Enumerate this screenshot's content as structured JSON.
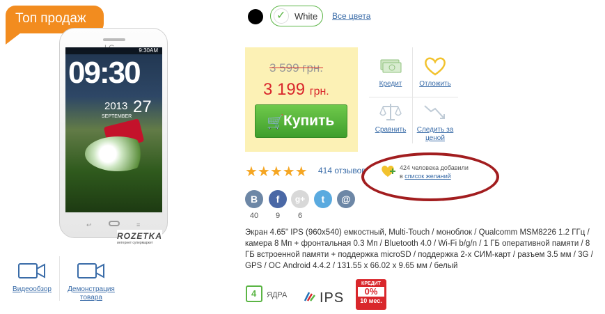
{
  "badge": {
    "label": "Топ продаж"
  },
  "phone": {
    "brand": "LG",
    "status_time": "9:30AM",
    "clock": "09:30",
    "year": "2013",
    "day": "27",
    "month": "SEPTEMBER"
  },
  "watermark": {
    "name": "ROZETKA",
    "tagline": "интернет супермаркет"
  },
  "media": {
    "review_label": "Видеообзор",
    "demo_label": "Демонстрация товара"
  },
  "colors": {
    "selected": "White",
    "all_label": "Все цвета",
    "options": [
      "#000000",
      "#ffffff"
    ]
  },
  "price": {
    "old": "3 599 грн.",
    "new_value": "3 199",
    "new_currency": "грн.",
    "buy_label": "Купить"
  },
  "actions": {
    "credit": "Кредит",
    "postpone": "Отложить",
    "compare": "Сравнить",
    "track_price": "Следить за ценой"
  },
  "rating": {
    "stars": 5,
    "reviews": "414 отзывов"
  },
  "wishlist": {
    "line1": "424 человека добавили",
    "line2_prefix": "в",
    "line2_link": "список желаний"
  },
  "social": [
    {
      "name": "vk",
      "glyph": "В",
      "count": "40",
      "color": "#6d87a6"
    },
    {
      "name": "facebook",
      "glyph": "f",
      "count": "9",
      "color": "#4a68a6"
    },
    {
      "name": "googleplus",
      "glyph": "g+",
      "count": "6",
      "color": "#d8d8d8"
    },
    {
      "name": "twitter",
      "glyph": "t",
      "count": "",
      "color": "#5aaadf"
    },
    {
      "name": "email",
      "glyph": "@",
      "count": "",
      "color": "#6d87a6"
    }
  ],
  "description": "Экран 4.65\" IPS (960x540) емкостный, Multi-Touch / моноблок / Qualcomm MSM8226 1.2 ГГц / камера 8 Мп + фронтальная 0.3 Мп / Bluetooth 4.0 / Wi-Fi b/g/n / 1 ГБ оперативной памяти / 8 ГБ встроенной памяти + поддержка microSD / поддержка 2-х СИМ-карт / разъем 3.5 мм / 3G / GPS / ОС Android 4.4.2 / 131.55 x 66.02 x 9.65 мм / белый",
  "features": {
    "cores_number": "4",
    "cores_label": "ЯДРА",
    "ips_label": "IPS",
    "credit_top": "КРЕДИТ",
    "credit_rate": "0%",
    "credit_term": "10 мес."
  }
}
